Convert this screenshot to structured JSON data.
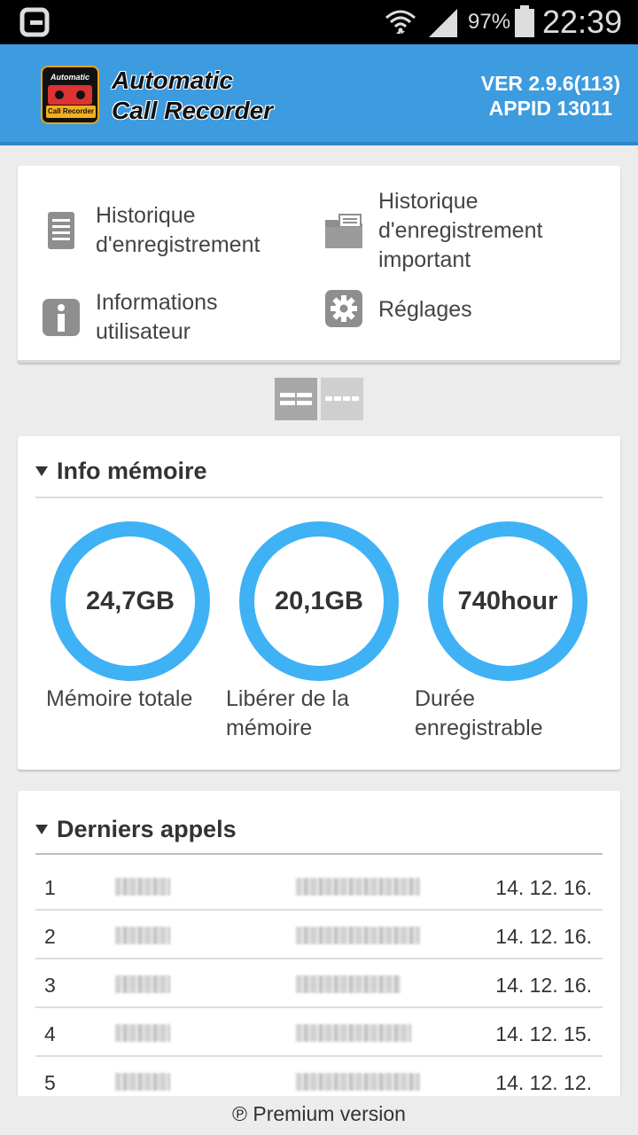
{
  "status_bar": {
    "battery_percent": "97%",
    "time": "22:39",
    "icons": [
      "carrier-logo-icon",
      "wifi-icon",
      "signal-icon",
      "battery-icon"
    ]
  },
  "header": {
    "app_name_line1": "Automatic",
    "app_name_line2": "Call Recorder",
    "logo_text_top": "Automatic",
    "logo_text_bottom": "Call Recorder",
    "version": "VER 2.9.6(113)",
    "appid": "APPID 13011",
    "background_color": "#3d9be0"
  },
  "menu": {
    "items": [
      {
        "label": "Historique\nd'enregistrement",
        "icon": "list-document-icon"
      },
      {
        "label": "Historique\nd'enregistrement\nimportant",
        "icon": "folder-icon"
      },
      {
        "label": "Informations\nutilisateur",
        "icon": "info-icon"
      },
      {
        "label": "Réglages",
        "icon": "gear-icon"
      }
    ]
  },
  "pager": {
    "pages": 2,
    "active": 1
  },
  "memory": {
    "title": "Info mémoire",
    "ring_color": "#3fb1f5",
    "gauges": [
      {
        "value": "24,7GB",
        "label": "Mémoire totale"
      },
      {
        "value": "20,1GB",
        "label": "Libérer de la\nmémoire"
      },
      {
        "value": "740hour",
        "label": "Durée\nenregistrable"
      }
    ]
  },
  "recent_calls": {
    "title": "Derniers appels",
    "rows": [
      {
        "index": "1",
        "date": "14. 12. 16."
      },
      {
        "index": "2",
        "date": "14. 12. 16."
      },
      {
        "index": "3",
        "date": "14. 12. 16."
      },
      {
        "index": "4",
        "date": "14. 12. 15."
      },
      {
        "index": "5",
        "date": "14. 12. 12."
      }
    ]
  },
  "footer": {
    "premium_label": "Premium version",
    "premium_symbol": "℗"
  }
}
